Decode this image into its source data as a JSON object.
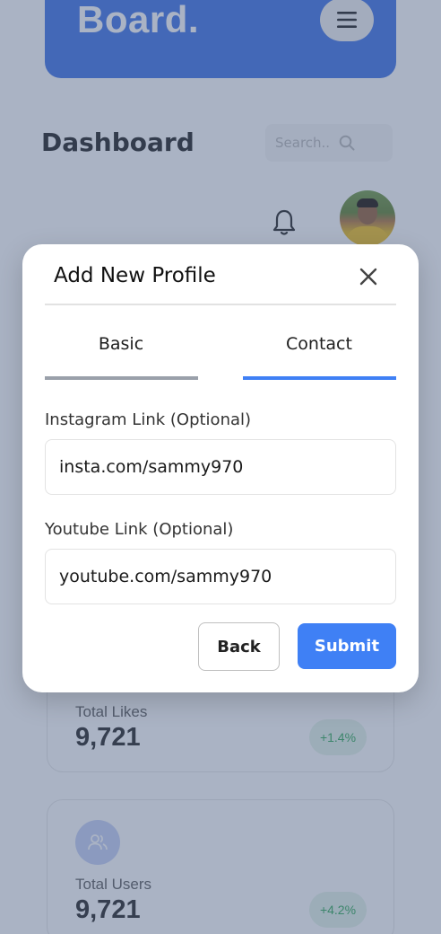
{
  "header": {
    "brand": "Board.",
    "menu_icon": "hamburger-icon"
  },
  "dashboard": {
    "title": "Dashboard",
    "search_placeholder": "Search..",
    "search_icon": "search-icon",
    "notification_icon": "bell-icon"
  },
  "stats": [
    {
      "label": "Total Likes",
      "value": "9,721",
      "change": "+1.4%"
    },
    {
      "label": "Total Users",
      "value": "9,721",
      "change": "+4.2%",
      "icon": "users-icon"
    }
  ],
  "modal": {
    "title": "Add New Profile",
    "close_icon": "close-icon",
    "tabs": [
      {
        "label": "Basic",
        "active": false
      },
      {
        "label": "Contact",
        "active": true
      }
    ],
    "fields": [
      {
        "label": "Instagram Link (Optional)",
        "value": "insta.com/sammy970"
      },
      {
        "label": "Youtube Link (Optional)",
        "value": "youtube.com/sammy970"
      }
    ],
    "back_label": "Back",
    "submit_label": "Submit"
  },
  "colors": {
    "accent": "#3f80f5",
    "header": "#4a7be8",
    "tab_inactive": "#9aa0aa",
    "badge_green": "#40b064"
  }
}
